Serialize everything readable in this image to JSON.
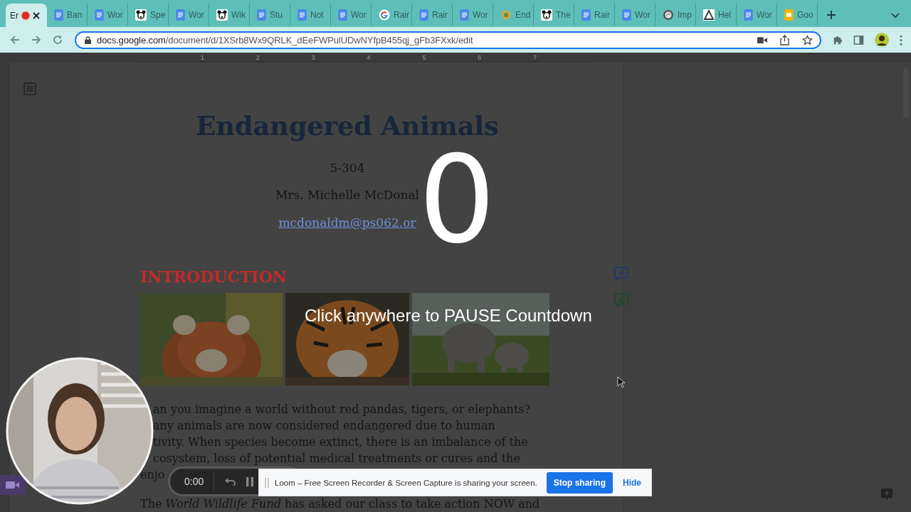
{
  "browser": {
    "tabs": [
      {
        "label": "Er",
        "kind": "plain",
        "selected": true,
        "recording": true
      },
      {
        "label": "Ban",
        "kind": "docs",
        "selected": false,
        "recording": false
      },
      {
        "label": "Wor",
        "kind": "docs",
        "selected": false,
        "recording": false
      },
      {
        "label": "Spe",
        "kind": "panda",
        "selected": false,
        "recording": false
      },
      {
        "label": "Wor",
        "kind": "docs",
        "selected": false,
        "recording": false
      },
      {
        "label": "Wik",
        "kind": "panda",
        "selected": false,
        "recording": false
      },
      {
        "label": "Stu",
        "kind": "docs",
        "selected": false,
        "recording": false
      },
      {
        "label": "Not",
        "kind": "docs",
        "selected": false,
        "recording": false
      },
      {
        "label": "Wor",
        "kind": "docs",
        "selected": false,
        "recording": false
      },
      {
        "label": "Rair",
        "kind": "google",
        "selected": false,
        "recording": false
      },
      {
        "label": "Rair",
        "kind": "docs",
        "selected": false,
        "recording": false
      },
      {
        "label": "Wor",
        "kind": "docs",
        "selected": false,
        "recording": false
      },
      {
        "label": "End",
        "kind": "badge",
        "selected": false,
        "recording": false
      },
      {
        "label": "The",
        "kind": "panda",
        "selected": false,
        "recording": false
      },
      {
        "label": "Rair",
        "kind": "docs",
        "selected": false,
        "recording": false
      },
      {
        "label": "Wor",
        "kind": "docs",
        "selected": false,
        "recording": false
      },
      {
        "label": "Imp",
        "kind": "globe",
        "selected": false,
        "recording": false
      },
      {
        "label": "Hel",
        "kind": "triangle",
        "selected": false,
        "recording": false
      },
      {
        "label": "Wor",
        "kind": "docs",
        "selected": false,
        "recording": false
      },
      {
        "label": "Goo",
        "kind": "slides",
        "selected": false,
        "recording": false
      }
    ],
    "address": {
      "host": "docs.google.com",
      "path": "/document/d/1XSrb8Wx9QRLK_dEeFWPulUDwNYfpB455qj_gFb3FXxk/edit"
    }
  },
  "ruler": {
    "labels": [
      "1",
      "2",
      "3",
      "4",
      "5",
      "6",
      "7"
    ]
  },
  "document": {
    "title": "Endangered Animals",
    "class_code": "5-304",
    "teacher": "Mrs. Michelle McDonal",
    "email": "mcdonaldm@ps062.or",
    "heading": "INTRODUCTION",
    "body_lines": [
      {
        "text": "an you imagine a world without red pandas, tigers, or elephants?",
        "kind": "partial"
      },
      {
        "text": "any animals are now considered endangered due to human",
        "kind": "partial"
      },
      {
        "text": "tivity.  When species become extinct, there is an imbalance of the",
        "kind": "partial"
      },
      {
        "text": "cosystem, loss of potential medical treatments or cures and the",
        "kind": "partial"
      },
      {
        "text": "enjo",
        "kind": "full"
      },
      {
        "text": "The *World Wildlife Fund* has asked our class to take action NOW and",
        "kind": "full"
      }
    ]
  },
  "countdown": {
    "number": "0",
    "hint": "Click anywhere to PAUSE Countdown"
  },
  "recorder": {
    "time": "0:00"
  },
  "share_bar": {
    "message": "Loom – Free Screen Recorder & Screen Capture is sharing your screen.",
    "stop": "Stop sharing",
    "hide": "Hide"
  }
}
